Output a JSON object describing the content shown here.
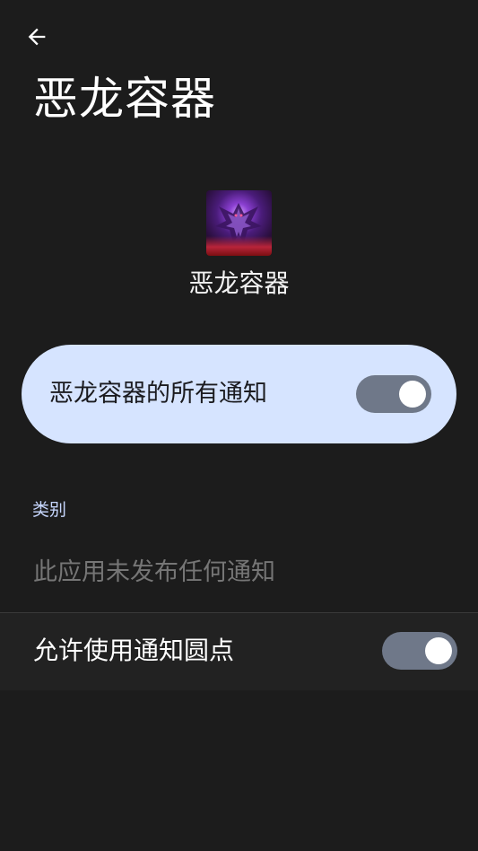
{
  "header": {
    "back_icon": "arrow-back-icon",
    "title": "恶龙容器"
  },
  "app": {
    "icon": "dragon-app-icon",
    "name": "恶龙容器"
  },
  "all_notifications": {
    "label": "恶龙容器的所有通知",
    "enabled": true
  },
  "categories": {
    "section_label": "类别",
    "empty_text": "此应用未发布任何通知"
  },
  "notification_dots": {
    "label": "允许使用通知圆点",
    "enabled": true
  },
  "colors": {
    "background": "#1c1c1c",
    "card_background": "#d6e4ff",
    "switch_track": "#6f7889",
    "section_label": "#c7d7ff"
  }
}
